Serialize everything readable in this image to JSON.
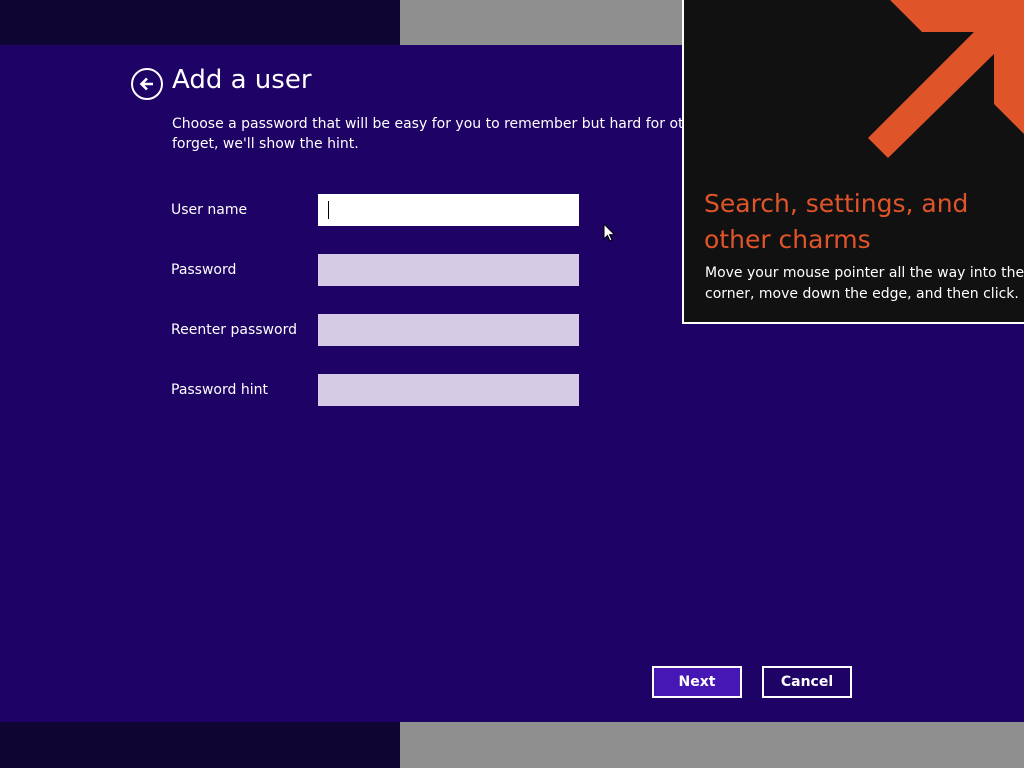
{
  "colors": {
    "dialog_background": "#1e0266",
    "input_background": "#d5cbe4",
    "input_focused_background": "#ffffff",
    "primary_button": "#4617b4",
    "charms_accent": "#e0542a",
    "charms_background": "#111111"
  },
  "header": {
    "back_icon": "back-arrow-circle-icon",
    "title": "Add a user",
    "description_line1": "Choose a password that will be easy for you to remember but hard for others",
    "description_line2": "forget, we'll show the hint."
  },
  "form": {
    "fields": [
      {
        "label": "User name",
        "value": ""
      },
      {
        "label": "Password",
        "value": ""
      },
      {
        "label": "Reenter password",
        "value": ""
      },
      {
        "label": "Password hint",
        "value": ""
      }
    ]
  },
  "buttons": {
    "next": "Next",
    "cancel": "Cancel"
  },
  "charms_tip": {
    "arrow_icon": "diagonal-arrow-up-right-icon",
    "title_line1": "Search, settings, and",
    "title_line2": "other charms",
    "body_line1": "Move your mouse pointer all the way into the",
    "body_line2": "corner, move down the edge, and then click."
  }
}
